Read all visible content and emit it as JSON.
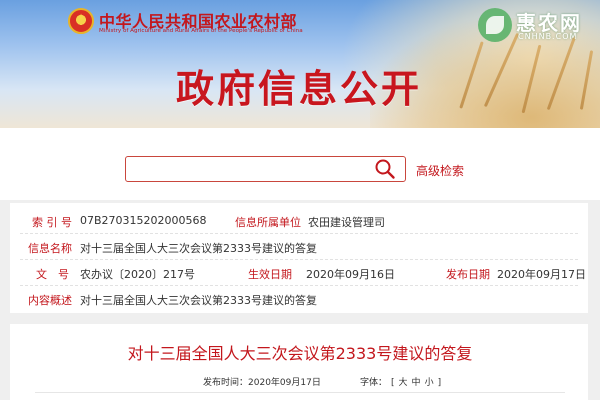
{
  "banner": {
    "ministry_cn": "中华人民共和国农业农村部",
    "ministry_en": "Ministry of Agriculture and Rural Affairs of the People's Republic of China",
    "title": "政府信息公开"
  },
  "watermark": {
    "name": "惠农网",
    "domain": "CNHNB.COM"
  },
  "search": {
    "placeholder": "",
    "icon": "search-icon",
    "advanced_label": "高级检索"
  },
  "meta": {
    "index_label": "索 引 号",
    "index_value": "07B270315202000568",
    "publisher_label": "信息所属单位",
    "publisher_value": "农田建设管理司",
    "name_label": "信息名称",
    "name_value": "对十三届全国人大三次会议第2333号建议的答复",
    "docno_label": "文　号",
    "docno_value": "农办议〔2020〕217号",
    "effective_label": "生效日期",
    "effective_value": "2020年09月16日",
    "release_label": "发布日期",
    "release_value": "2020年09月17日",
    "summary_label": "内容概述",
    "summary_value": "对十三届全国人大三次会议第2333号建议的答复"
  },
  "article": {
    "title": "对十三届全国人大三次会议第2333号建议的答复",
    "pub_time_label": "发布时间：",
    "pub_time_value": "2020年09月17日",
    "font_label": "字体：",
    "font_open": "[",
    "font_large": "大",
    "font_medium": "中",
    "font_small": "小",
    "font_close": "]"
  },
  "colors": {
    "accent_red": "#c3171d",
    "panel_bg": "#ffffff",
    "page_bg": "#efefef"
  }
}
